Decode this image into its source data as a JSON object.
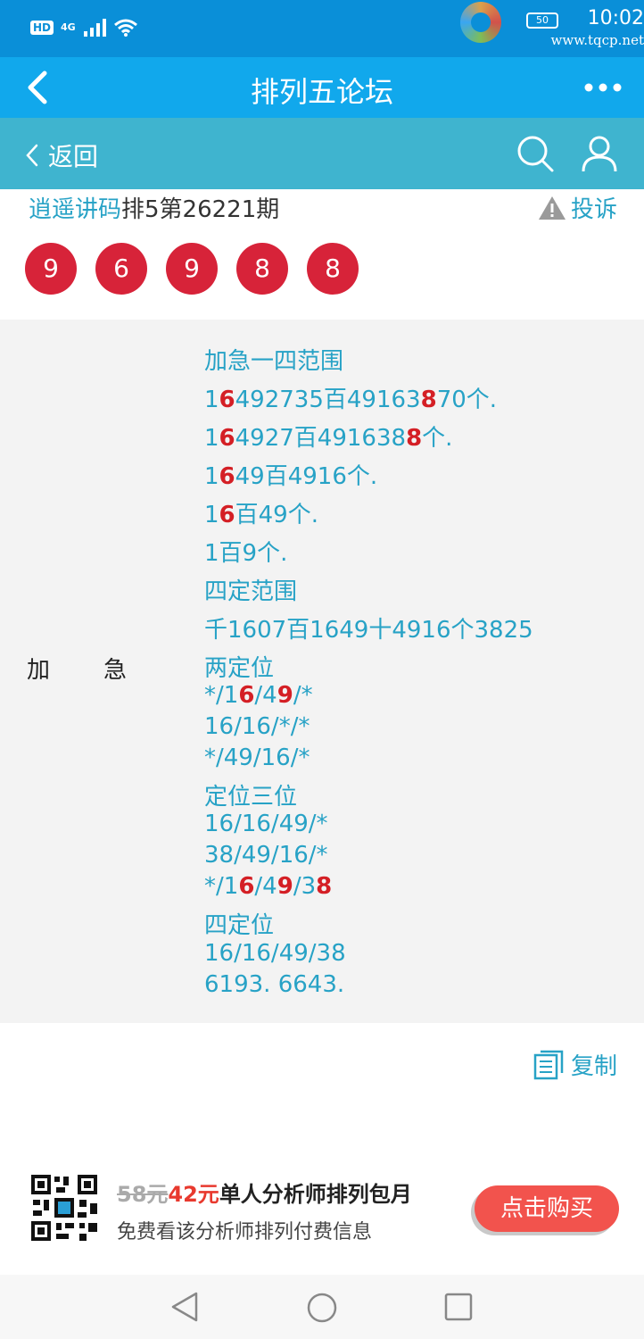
{
  "status_bar": {
    "hd": "HD",
    "network": "4G",
    "battery": "50",
    "time": "10:02",
    "watermark_url": "www.tqcp.net"
  },
  "titlebar": {
    "title": "排列五论坛"
  },
  "subbar": {
    "back_label": "返回"
  },
  "post": {
    "author": "逍遥讲码",
    "issue": "排5第26221期",
    "report_label": "投诉",
    "balls": [
      "9",
      "6",
      "9",
      "8",
      "8"
    ],
    "row_label": "加急",
    "lines": [
      [
        {
          "t": "加急一四范围"
        }
      ],
      [
        {
          "t": "1"
        },
        {
          "t": "6",
          "r": true
        },
        {
          "t": "492735百49163"
        },
        {
          "t": "8",
          "r": true
        },
        {
          "t": "70个."
        }
      ],
      [
        {
          "t": "1"
        },
        {
          "t": "6",
          "r": true
        },
        {
          "t": "4927百491638"
        },
        {
          "t": "8",
          "r": true,
          "replace": true
        },
        {
          "t": "个."
        }
      ],
      [
        {
          "t": "1"
        },
        {
          "t": "6",
          "r": true
        },
        {
          "t": "49百4916个."
        }
      ],
      [
        {
          "t": "1"
        },
        {
          "t": "6",
          "r": true
        },
        {
          "t": "百49个."
        }
      ],
      [
        {
          "t": "1百9个."
        }
      ],
      [
        {
          "t": "四定范围"
        }
      ],
      [
        {
          "t": "千1607百1649十4916个3825"
        }
      ],
      [
        {
          "t": "两定位"
        }
      ],
      [
        {
          "t": "*/1"
        },
        {
          "t": "6",
          "r": true
        },
        {
          "t": "/4"
        },
        {
          "t": "9",
          "r": true
        },
        {
          "t": "/*"
        }
      ],
      [
        {
          "t": "16/16/*/*"
        }
      ],
      [
        {
          "t": "*/49/16/*"
        }
      ],
      [
        {
          "t": "定位三位"
        }
      ],
      [
        {
          "t": "16/16/49/*"
        }
      ],
      [
        {
          "t": "38/49/16/*"
        }
      ],
      [
        {
          "t": "*/1"
        },
        {
          "t": "6",
          "r": true
        },
        {
          "t": "/4"
        },
        {
          "t": "9",
          "r": true
        },
        {
          "t": "/3"
        },
        {
          "t": "8",
          "r": true
        }
      ],
      [
        {
          "t": "四定位"
        }
      ],
      [
        {
          "t": "16/16/49/38"
        }
      ],
      [
        {
          "t": "6193. 6643."
        }
      ]
    ],
    "copy_label": "复制"
  },
  "promo": {
    "old_price": "58元",
    "new_price": "42元",
    "title_rest": "单人分析师排列包月",
    "subtitle": "免费看该分析师排列付费信息",
    "buy_label": "点击购买"
  }
}
